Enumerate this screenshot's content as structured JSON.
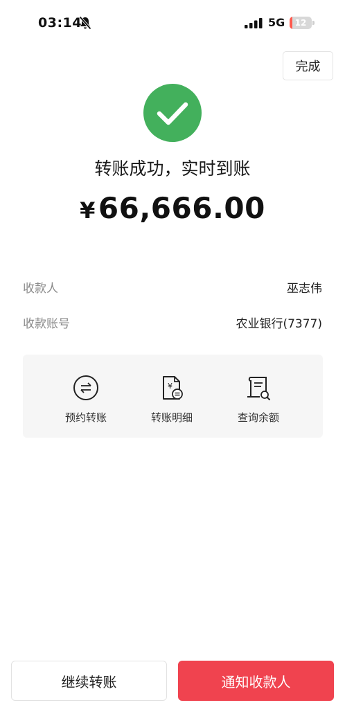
{
  "status_bar": {
    "time": "03:14",
    "network": "5G",
    "battery_percent": 12,
    "battery_label": "12"
  },
  "header": {
    "done_label": "完成"
  },
  "result": {
    "title": "转账成功，实时到账",
    "currency_symbol": "¥",
    "amount": "66,666.00"
  },
  "details": {
    "payee_label": "收款人",
    "payee_value": "巫志伟",
    "account_label": "收款账号",
    "account_value": "农业银行(7377)"
  },
  "actions": [
    {
      "label": "预约转账",
      "icon": "scheduled-transfer-icon"
    },
    {
      "label": "转账明细",
      "icon": "transfer-details-icon"
    },
    {
      "label": "查询余额",
      "icon": "check-balance-icon"
    }
  ],
  "footer": {
    "continue_label": "继续转账",
    "notify_label": "通知收款人"
  },
  "colors": {
    "success": "#43b05c",
    "primary": "#f0434f",
    "battery_low": "#ff5a4e"
  }
}
